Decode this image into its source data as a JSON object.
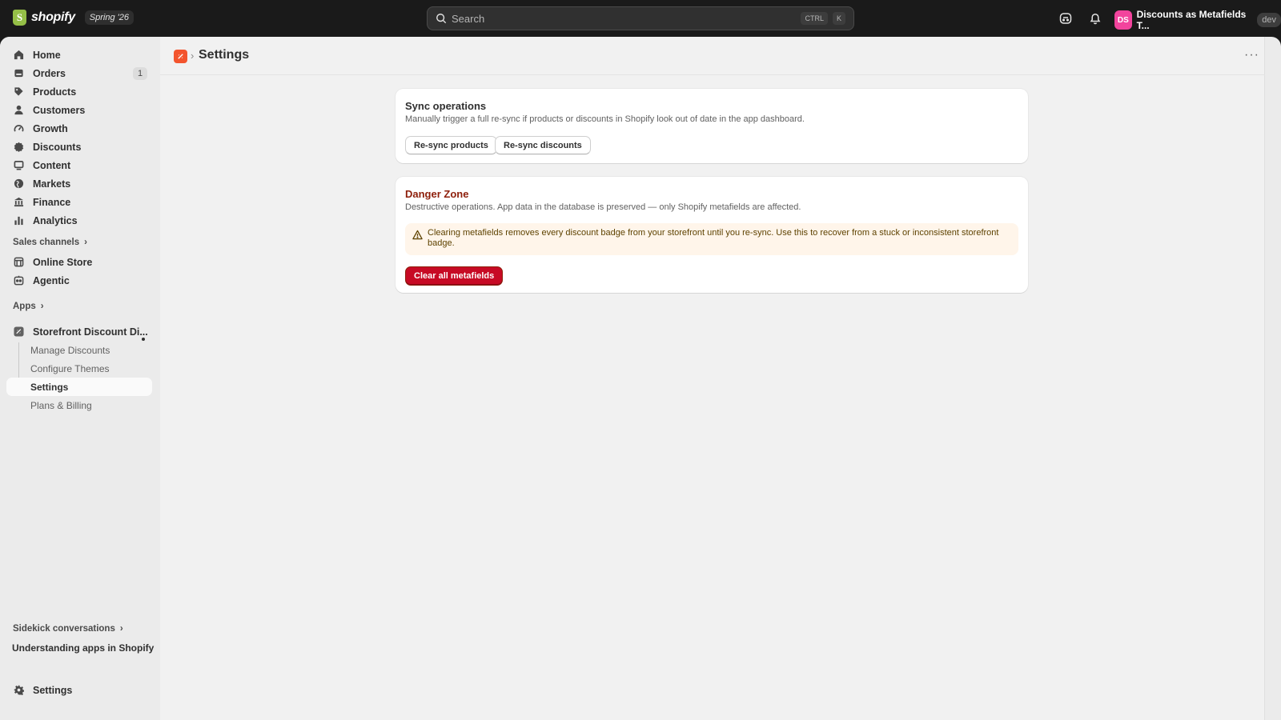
{
  "topbar": {
    "logo_text": "shopify",
    "logo_glyph": "S",
    "release_badge": "Spring '26",
    "search_placeholder": "Search",
    "shortcut_ctrl": "CTRL",
    "shortcut_key": "K",
    "store_initials": "DS",
    "store_name": "Discounts as Metafields T...",
    "env_badge": "dev",
    "avatar_color": "#f2449d"
  },
  "sidebar": {
    "items": [
      {
        "label": "Home",
        "icon": "home-icon"
      },
      {
        "label": "Orders",
        "icon": "orders-icon",
        "count": "1"
      },
      {
        "label": "Products",
        "icon": "tag-icon"
      },
      {
        "label": "Customers",
        "icon": "person-icon"
      },
      {
        "label": "Growth",
        "icon": "gauge-icon"
      },
      {
        "label": "Discounts",
        "icon": "discount-icon"
      },
      {
        "label": "Content",
        "icon": "content-icon"
      },
      {
        "label": "Markets",
        "icon": "globe-icon"
      },
      {
        "label": "Finance",
        "icon": "bank-icon"
      },
      {
        "label": "Analytics",
        "icon": "bar-chart-icon"
      }
    ],
    "sales_channels_label": "Sales channels",
    "channels": [
      {
        "label": "Online Store",
        "icon": "store-icon"
      },
      {
        "label": "Agentic",
        "icon": "agentic-icon"
      }
    ],
    "apps_label": "Apps",
    "app": {
      "label": "Storefront Discount Di...",
      "subitems": [
        "Manage Discounts",
        "Configure Themes",
        "Settings",
        "Plans & Billing"
      ]
    },
    "sidekick_label": "Sidekick conversations",
    "sidekick_item": "Understanding apps in Shopify",
    "settings_label": "Settings"
  },
  "page": {
    "title": "Settings",
    "more_label": "···"
  },
  "sync_card": {
    "title": "Sync operations",
    "description": "Manually trigger a full re-sync if products or discounts in Shopify look out of date in the app dashboard.",
    "resync_products": "Re-sync products",
    "resync_discounts": "Re-sync discounts"
  },
  "danger_card": {
    "title": "Danger Zone",
    "description": "Destructive operations. App data in the database is preserved — only Shopify metafields are affected.",
    "warning_line1": "Clearing metafields removes every discount badge from your storefront until you re-sync. Use this to recover from a stuck or inconsistent storefront",
    "warning_line2": "badge.",
    "clear_button": "Clear all metafields",
    "danger_color": "#c70a24"
  }
}
